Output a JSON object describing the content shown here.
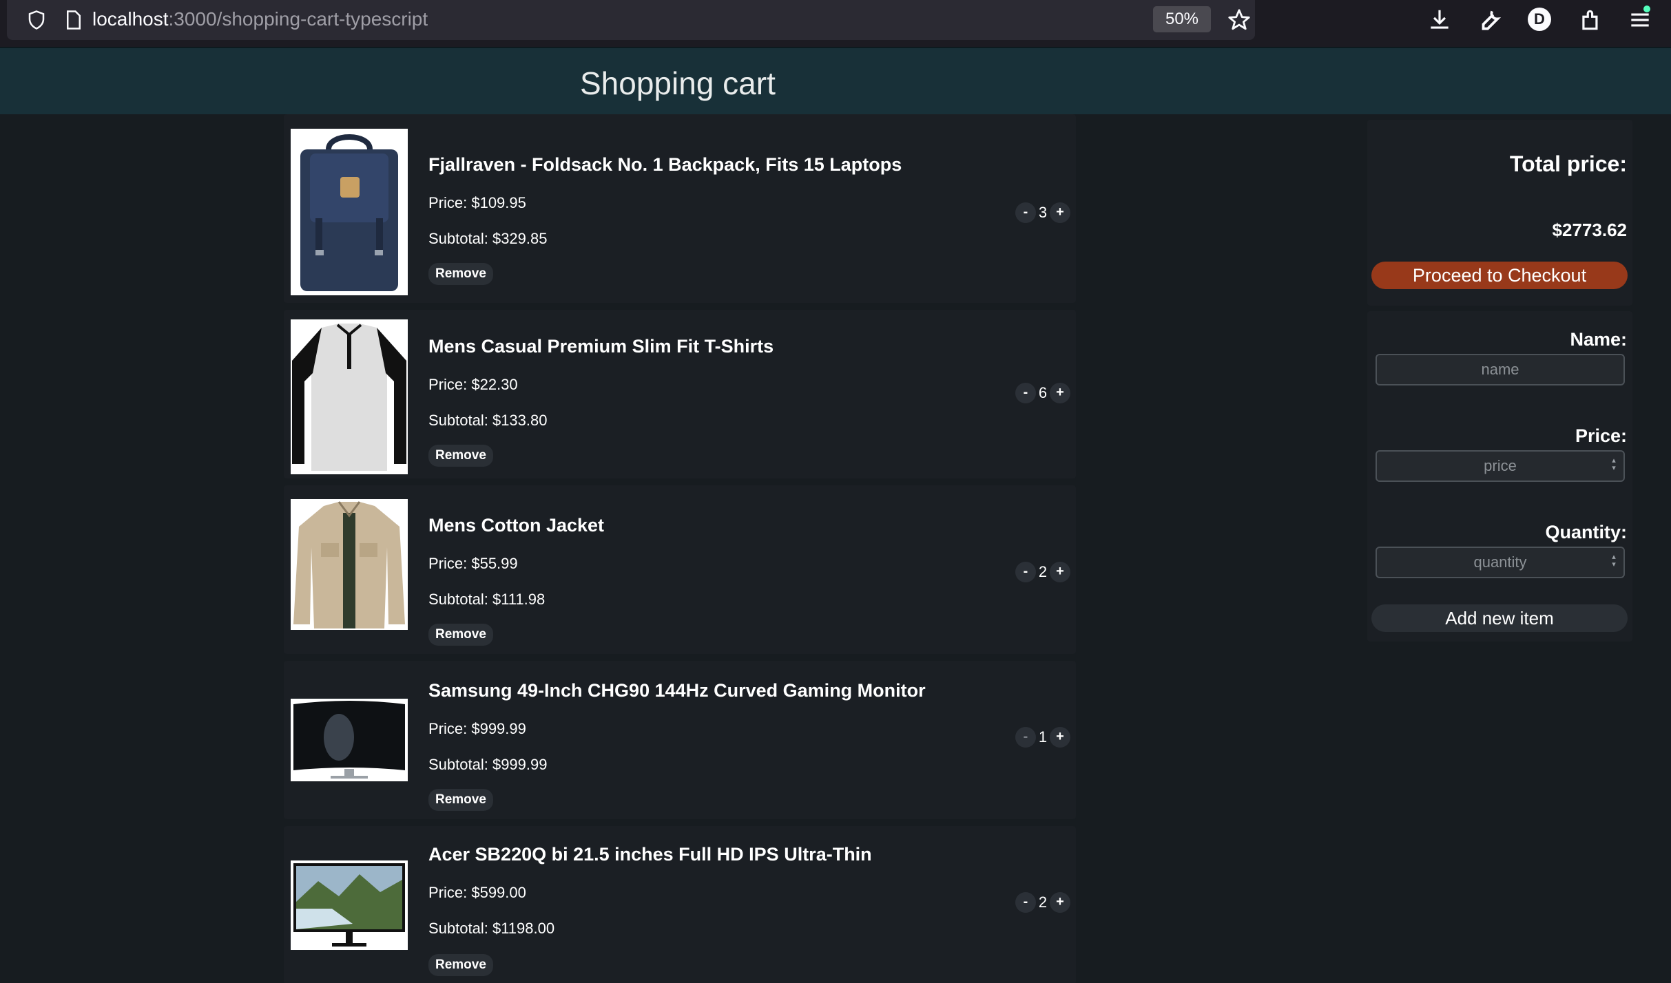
{
  "browser": {
    "url_host": "localhost",
    "url_path": ":3000/shopping-cart-typescript",
    "zoom": "50%",
    "avatar_letter": "D"
  },
  "header": {
    "title": "Shopping cart"
  },
  "cart": {
    "items": [
      {
        "name": "Fjallraven - Foldsack No. 1 Backpack, Fits 15 Laptops",
        "price": "Price: $109.95",
        "subtotal": "Subtotal: $329.85",
        "quantity": "3",
        "remove_label": "Remove",
        "minus": "-",
        "plus": "+",
        "image": "backpack"
      },
      {
        "name": "Mens Casual Premium Slim Fit T-Shirts",
        "price": "Price: $22.30",
        "subtotal": "Subtotal: $133.80",
        "quantity": "6",
        "remove_label": "Remove",
        "minus": "-",
        "plus": "+",
        "image": "tshirt"
      },
      {
        "name": "Mens Cotton Jacket",
        "price": "Price: $55.99",
        "subtotal": "Subtotal: $111.98",
        "quantity": "2",
        "remove_label": "Remove",
        "minus": "-",
        "plus": "+",
        "image": "jacket"
      },
      {
        "name": "Samsung 49-Inch CHG90 144Hz Curved Gaming Monitor",
        "price": "Price: $999.99",
        "subtotal": "Subtotal: $999.99",
        "quantity": "1",
        "remove_label": "Remove",
        "minus": "-",
        "plus": "+",
        "image": "monitor"
      },
      {
        "name": "Acer SB220Q bi 21.5 inches Full HD IPS Ultra-Thin",
        "price": "Price: $599.00",
        "subtotal": "Subtotal: $1198.00",
        "quantity": "2",
        "remove_label": "Remove",
        "minus": "-",
        "plus": "+",
        "image": "acer-monitor"
      }
    ]
  },
  "summary": {
    "total_label": "Total price:",
    "total_value": "$2773.62",
    "checkout_label": "Proceed to Checkout"
  },
  "form": {
    "name_label": "Name:",
    "name_placeholder": "name",
    "price_label": "Price:",
    "price_placeholder": "price",
    "quantity_label": "Quantity:",
    "quantity_placeholder": "quantity",
    "add_label": "Add new item"
  },
  "colors": {
    "header_bg": "#183038",
    "page_bg": "#171c20",
    "checkout_bg": "#98391a"
  }
}
